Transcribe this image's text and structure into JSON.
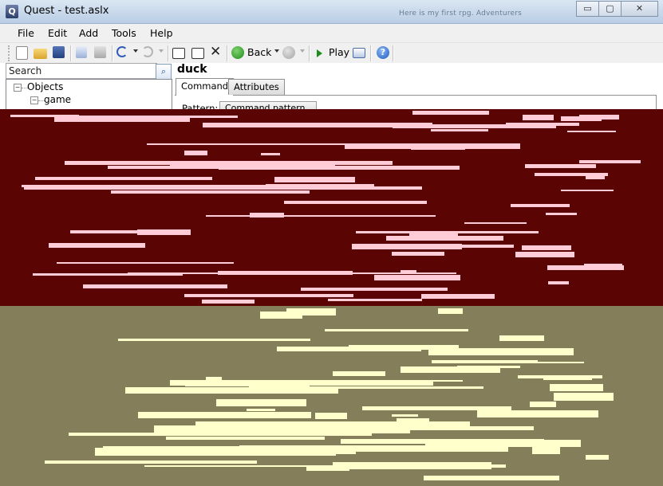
{
  "window": {
    "title": "Quest - test.aslx",
    "app_icon_letter": "Q",
    "title_glimpse": "Here is my first rpg. Adventurers",
    "buttons": {
      "minimize": "▭",
      "maximize": "▢",
      "close": "✕"
    }
  },
  "menu": {
    "items": [
      "File",
      "Edit",
      "Add",
      "Tools",
      "Help"
    ]
  },
  "toolbar": {
    "back_label": "Back",
    "play_label": "Play"
  },
  "search": {
    "value": "Search"
  },
  "tree": {
    "root": {
      "label": "Objects",
      "expander": "−"
    },
    "child": {
      "label": "game",
      "expander": "−"
    }
  },
  "editor": {
    "object_name": "duck",
    "tabs": [
      "Command",
      "Attributes"
    ],
    "active_tab": "Command",
    "pattern_label": "Pattern:",
    "pattern_value": "Command pattern"
  },
  "colors": {
    "glitch_top_base": "#5a0404",
    "glitch_top_stripe": "#ffccd8",
    "glitch_bottom_base": "#857e5a",
    "glitch_bottom_stripe": "#ffffcc"
  }
}
